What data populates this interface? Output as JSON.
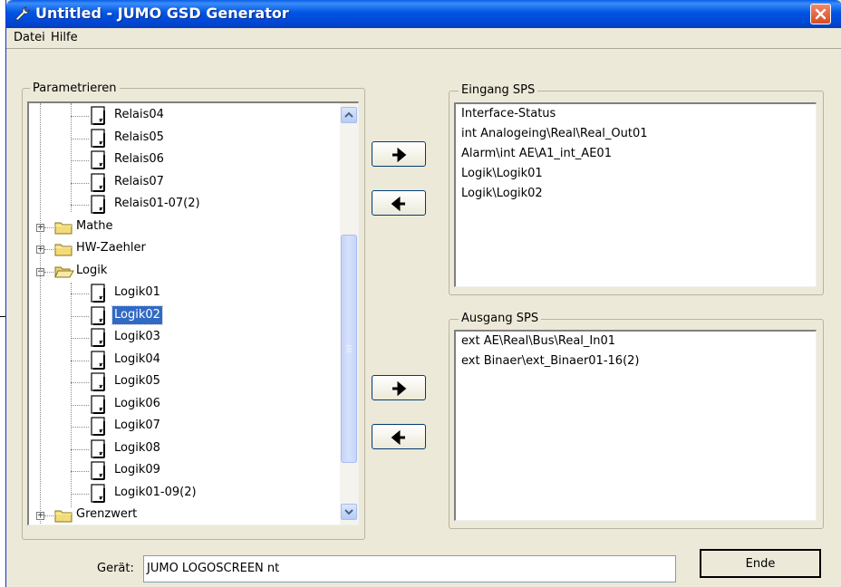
{
  "window": {
    "title": "Untitled - JUMO GSD Generator"
  },
  "menu": [
    {
      "label": "Datei"
    },
    {
      "label": "Hilfe"
    }
  ],
  "parametrieren": {
    "label": "Parametrieren",
    "tree": [
      {
        "label": "Relais04",
        "type": "doc"
      },
      {
        "label": "Relais05",
        "type": "doc"
      },
      {
        "label": "Relais06",
        "type": "doc"
      },
      {
        "label": "Relais07",
        "type": "doc"
      },
      {
        "label": "Relais01-07(2)",
        "type": "doc"
      },
      {
        "label": "Mathe",
        "type": "folder",
        "expand": "+"
      },
      {
        "label": "HW-Zaehler",
        "type": "folder",
        "expand": "+"
      },
      {
        "label": "Logik",
        "type": "folder-open",
        "expand": "−"
      },
      {
        "label": "Logik01",
        "type": "doc"
      },
      {
        "label": "Logik02",
        "type": "doc",
        "selected": true
      },
      {
        "label": "Logik03",
        "type": "doc"
      },
      {
        "label": "Logik04",
        "type": "doc"
      },
      {
        "label": "Logik05",
        "type": "doc"
      },
      {
        "label": "Logik06",
        "type": "doc"
      },
      {
        "label": "Logik07",
        "type": "doc"
      },
      {
        "label": "Logik08",
        "type": "doc"
      },
      {
        "label": "Logik09",
        "type": "doc"
      },
      {
        "label": "Logik01-09(2)",
        "type": "doc"
      },
      {
        "label": "Grenzwert",
        "type": "folder",
        "expand": "+"
      }
    ]
  },
  "eingang": {
    "label": "Eingang SPS",
    "items": [
      "Interface-Status",
      "int Analogeing\\Real\\Real_Out01",
      "Alarm\\int AE\\A1_int_AE01",
      "Logik\\Logik01",
      "Logik\\Logik02"
    ]
  },
  "ausgang": {
    "label": "Ausgang SPS",
    "items": [
      "ext AE\\Real\\Bus\\Real_In01",
      "ext Binaer\\ext_Binaer01-16(2)"
    ]
  },
  "footer": {
    "geraet_label": "Gerät:",
    "geraet_value": "JUMO LOGOSCREEN nt",
    "ende_label": "Ende"
  },
  "icons": {
    "app": "wrench-icon",
    "close": "close-icon",
    "add": "arrow-right-icon",
    "remove": "arrow-left-icon"
  },
  "colors": {
    "titlebar": "#0054e3",
    "selection": "#316ac5",
    "close": "#d64a22",
    "window_bg": "#ece9d8"
  }
}
